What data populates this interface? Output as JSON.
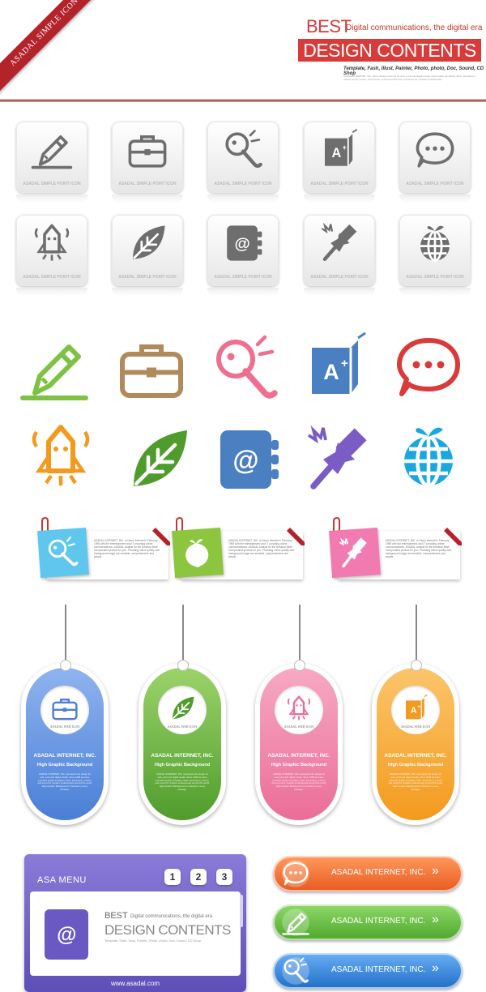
{
  "header": {
    "ribbon": "ASADAL SIMPLE ICON",
    "best": "BEST",
    "best_sub": "Digital communications, the digital era",
    "design": "DESIGN CONTENTS",
    "tagline": "Template, Fash, Illust, Painter, Photo, photo, Doc, Sound, CD Shop",
    "fine_print": "ASADAL INTERNET, INC. offers design contents for web, print and digital media. High quality templates, flash, illustrations, painter works, photos, documents, sound and CD shop resources for creative professionals."
  },
  "tile_label": "ASADAL SIMPLE POINT ICON",
  "tiles_row1": [
    "pencil-icon",
    "briefcase-icon",
    "magnifier-icon",
    "book-icon",
    "speech-bubble-icon"
  ],
  "tiles_row2": [
    "rocket-icon",
    "leaf-icon",
    "address-book-icon",
    "pushpin-icon",
    "globe-icon"
  ],
  "colors": {
    "green": "#7dc242",
    "tan": "#b08a5a",
    "pink": "#ee6f8f",
    "blue": "#4a7fc1",
    "red": "#d93a3a",
    "orange": "#f39a1e",
    "purple": "#7b5cc4",
    "cyan": "#1aa7e0",
    "leaf_green": "#4f9c2c"
  },
  "notes": {
    "text": "ASADAL INTERNET, INC. Is Daum Internet in February 1998 with the entertainment and IT providing online communications. ASADAL Analyst for the Desktop Best! Incorporated product for you. Providing online quality web background image are sensible, comprehensive and simple."
  },
  "tags": {
    "web_icon": "ASADAL WEB ICON",
    "company": "ASADAL INTERNET, INC.",
    "bg_label": "High Graphic Background",
    "body": "ASADAL INTERNET, INC. represents the design for web, print and digital media. Since 1998 we have provided quality templates, flash, illustrations, photos and sound for creative professionals around the world. High Graphic Background is included in every package."
  },
  "menu": {
    "title": "ASA MENU",
    "numbers": [
      "1",
      "2",
      "3"
    ],
    "best": "BEST",
    "best_sub": "Digital communications, the digital era",
    "design": "DESIGN CONTENTS",
    "tagline": "Template, Fash, Illust, Painter, Photo, photo, Doc, Sound, CD Shop",
    "url": "www.asadal.com"
  },
  "pills": [
    {
      "label": "ASADAL INTERNET, INC.",
      "color": "#f06a2e",
      "icon": "speech-bubble-icon"
    },
    {
      "label": "ASADAL INTERNET, INC.",
      "color": "#5cb83a",
      "icon": "pencil-icon"
    },
    {
      "label": "ASADAL INTERNET, INC.",
      "color": "#2f7fd6",
      "icon": "magnifier-icon"
    }
  ],
  "chevron": "»"
}
